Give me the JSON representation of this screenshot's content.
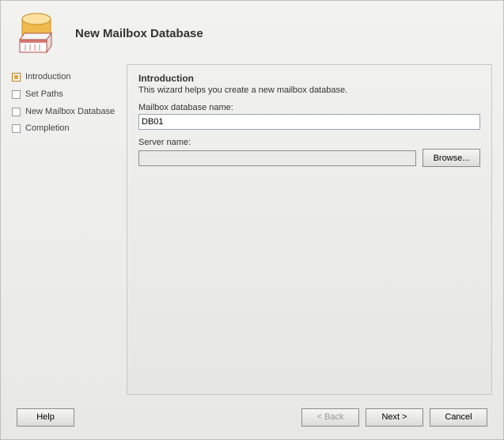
{
  "header": {
    "title": "New Mailbox Database"
  },
  "sidebar": {
    "steps": [
      {
        "label": "Introduction",
        "active": true
      },
      {
        "label": "Set Paths",
        "active": false
      },
      {
        "label": "New Mailbox Database",
        "active": false
      },
      {
        "label": "Completion",
        "active": false
      }
    ]
  },
  "main": {
    "section_title": "Introduction",
    "section_desc": "This wizard helps you create a new mailbox database.",
    "db_label": "Mailbox database name:",
    "db_value": "DB01",
    "server_label": "Server name:",
    "server_value": "",
    "browse_label": "Browse..."
  },
  "footer": {
    "help": "Help",
    "back": "< Back",
    "next": "Next >",
    "cancel": "Cancel"
  }
}
